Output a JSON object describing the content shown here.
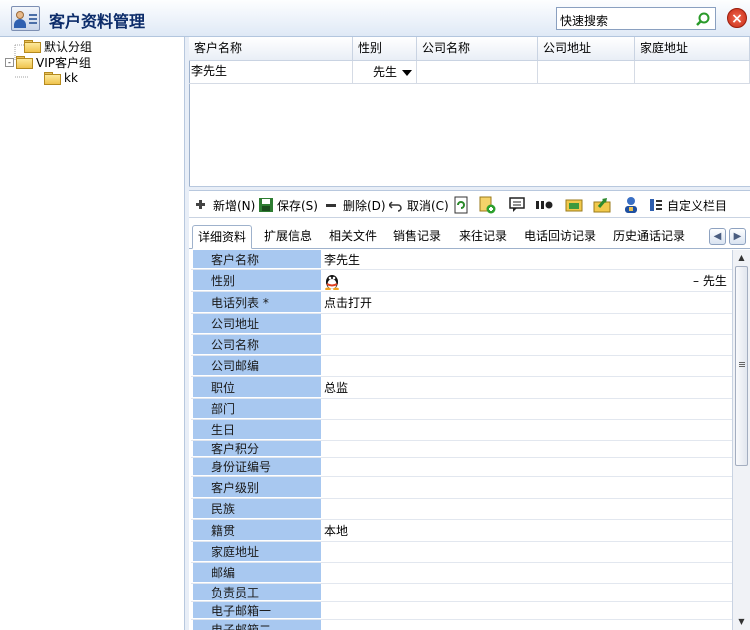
{
  "app": {
    "title": "客户资料管理",
    "search_placeholder": "快速搜索"
  },
  "tree": {
    "items": [
      {
        "label": "默认分组",
        "level": 0
      },
      {
        "label": "VIP客户组",
        "level": 0,
        "expander": "-"
      },
      {
        "label": "kk",
        "level": 1
      }
    ]
  },
  "grid": {
    "columns": [
      "客户名称",
      "性别",
      "公司名称",
      "公司地址",
      "家庭地址"
    ],
    "rows": [
      {
        "name": "李先生",
        "gender": "先生",
        "company": "",
        "address": "",
        "home": ""
      }
    ]
  },
  "toolbar": {
    "new_label": "新增(N)",
    "save_label": "保存(S)",
    "delete_label": "删除(D)",
    "cancel_label": "取消(C)",
    "custom_label": "自定义栏目"
  },
  "tabs": [
    "详细资料",
    "扩展信息",
    "相关文件",
    "销售记录",
    "来往记录",
    "电话回访记录",
    "历史通话记录"
  ],
  "detail": {
    "fields": [
      {
        "label": "客户名称",
        "value": "李先生"
      },
      {
        "label": "性别",
        "value": ""
      },
      {
        "label": "电话列表 *",
        "value": "点击打开"
      },
      {
        "label": "公司地址",
        "value": ""
      },
      {
        "label": "公司名称",
        "value": ""
      },
      {
        "label": "公司邮编",
        "value": ""
      },
      {
        "label": "职位",
        "value": "总监"
      },
      {
        "label": "部门",
        "value": ""
      },
      {
        "label": "生日",
        "value": ""
      },
      {
        "label": "客户积分",
        "value": ""
      },
      {
        "label": "身份证编号",
        "value": ""
      },
      {
        "label": "客户级别",
        "value": ""
      },
      {
        "label": "民族",
        "value": ""
      },
      {
        "label": "籍贯",
        "value": "本地"
      },
      {
        "label": "家庭地址",
        "value": ""
      },
      {
        "label": "邮编",
        "value": ""
      },
      {
        "label": "负责员工",
        "value": ""
      },
      {
        "label": "电子邮箱一",
        "value": ""
      },
      {
        "label": "电子邮箱二",
        "value": ""
      }
    ],
    "gender_select": "– 先生"
  },
  "colors": {
    "label_bg": "#a8c8f0",
    "title_color": "#0c2c6a",
    "accent": "#2f60b0"
  },
  "icons": [
    "app-icon",
    "search-icon",
    "close-icon",
    "folder-icon",
    "plus-icon",
    "save-icon",
    "minus-icon",
    "undo-icon",
    "qq-icon",
    "scroll-left-icon",
    "scroll-right-icon"
  ]
}
